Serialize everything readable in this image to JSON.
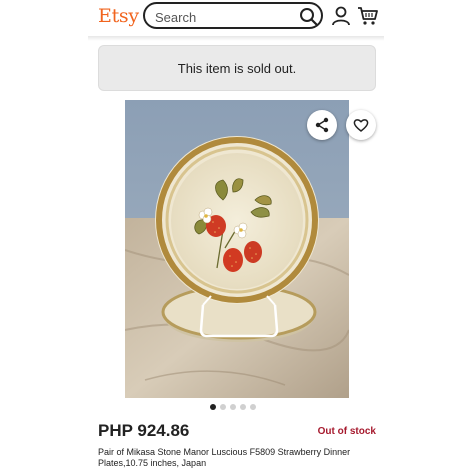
{
  "header": {
    "logo": "Etsy",
    "search_placeholder": "Search",
    "icons": [
      "search-icon",
      "user-icon",
      "cart-icon"
    ]
  },
  "banner": {
    "text": "This item is sold out."
  },
  "carousel": {
    "image_count": 5,
    "active_index": 0
  },
  "actions": {
    "icons": [
      "share-icon",
      "heart-icon"
    ]
  },
  "listing": {
    "price": "PHP 924.86",
    "stock_status": "Out of stock",
    "title": "Pair of Mikasa Stone Manor Luscious F5809 Strawberry Dinner Plates,10.75 inches, Japan"
  },
  "colors": {
    "brand": "#F1641E",
    "stock_status": "#A61A2E",
    "banner_bg": "#EAEAEA"
  }
}
